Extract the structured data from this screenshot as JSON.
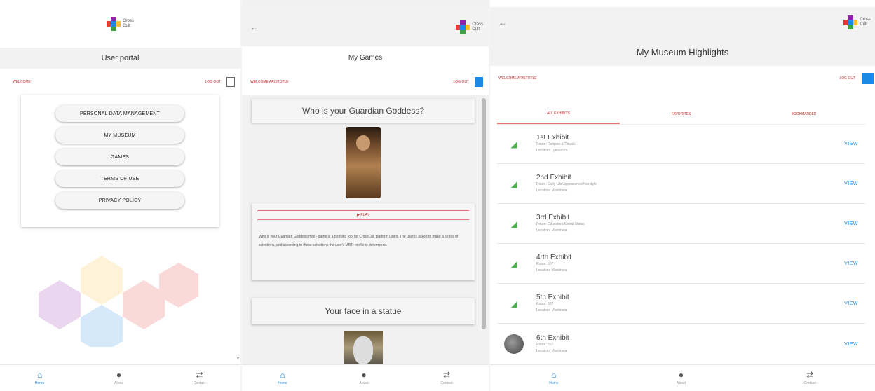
{
  "brand": {
    "line1": "Cross",
    "line2": "Cult"
  },
  "portal": {
    "title": "User portal",
    "welcome": "WELCOME",
    "logout": "LOG OUT",
    "menu_buttons": [
      "PERSONAL DATA MANAGEMENT",
      "MY MUSEUM",
      "GAMES",
      "TERMS OF USE",
      "PRIVACY POLICY"
    ]
  },
  "games": {
    "title": "My Games",
    "welcome": "WELCOME ARISTOTLE",
    "logout": "LOG OUT",
    "game1": {
      "title": "Who is your Guardian Goddess?",
      "play_label": "PLAY",
      "description": "Who is your Guardian Goddess mini - game is a profiling tool for CrossCult platform users. The user is asked to make a series of selections, and according to these selections the user's MBTI profile is determined."
    },
    "game2": {
      "title": "Your face in a statue"
    }
  },
  "museum": {
    "title": "My Museum Highlights",
    "welcome": "WELCOME ARISTOTLE",
    "logout": "LOG OUT",
    "tabs": [
      "ALL EXHIBITS",
      "FAVORITES",
      "BOOKMARKED"
    ],
    "view_label": "VIEW",
    "exhibits": [
      {
        "name": "1st Exhibit",
        "route": "Route: Religion & Rituals",
        "location": "Location: Lykosoura"
      },
      {
        "name": "2nd Exhibit",
        "route": "Route: Daily Life/Appearance/Hairstyle",
        "location": "Location: Mantineia"
      },
      {
        "name": "3rd Exhibit",
        "route": "Route: Education/Social Status",
        "location": "Location: Mantineia"
      },
      {
        "name": "4rth Exhibit",
        "route": "Route: 567",
        "location": "Location: Mantineia"
      },
      {
        "name": "5th Exhibit",
        "route": "Route: 567",
        "location": "Location: Mantineia"
      },
      {
        "name": "6th Exhibit",
        "route": "Route: 567",
        "location": "Location: Mantineia"
      }
    ]
  },
  "nav": [
    "Home",
    "About",
    "Contact"
  ],
  "colors": {
    "accent": "#1e88e5",
    "welcome_red": "#c62828"
  }
}
